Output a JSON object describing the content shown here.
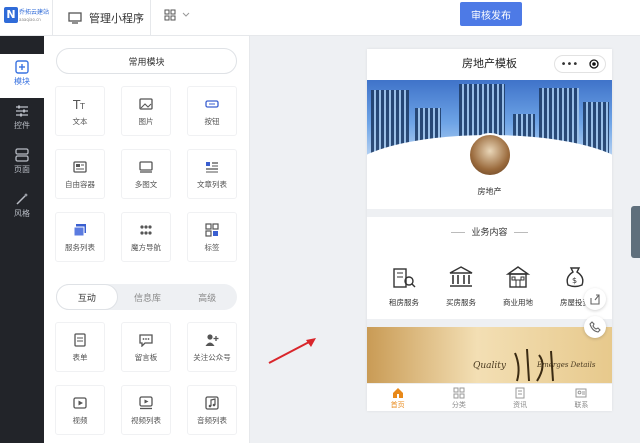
{
  "header": {
    "logo_text": "乔拓云建站",
    "logo_sub": "aaaqiao.cn",
    "manage_label": "管理小程序",
    "publish_label": "审核发布"
  },
  "leftnav": [
    {
      "label": "模块",
      "icon": "plus-square-icon",
      "active": true
    },
    {
      "label": "控件",
      "icon": "sliders-icon",
      "active": false
    },
    {
      "label": "页面",
      "icon": "pages-icon",
      "active": false
    },
    {
      "label": "风格",
      "icon": "magic-wand-icon",
      "active": false
    }
  ],
  "panel": {
    "common_title": "常用模块",
    "common_items": [
      {
        "label": "文本",
        "icon": "text-icon"
      },
      {
        "label": "图片",
        "icon": "image-icon"
      },
      {
        "label": "按钮",
        "icon": "button-icon"
      },
      {
        "label": "自由容器",
        "icon": "container-icon"
      },
      {
        "label": "多图文",
        "icon": "multi-image-icon"
      },
      {
        "label": "文章列表",
        "icon": "article-list-icon"
      },
      {
        "label": "服务列表",
        "icon": "service-list-icon"
      },
      {
        "label": "魔方导航",
        "icon": "cube-nav-icon"
      },
      {
        "label": "标签",
        "icon": "tag-icon"
      }
    ],
    "tabs": [
      "互动",
      "信息库",
      "高级"
    ],
    "interact_items": [
      {
        "label": "表单",
        "icon": "form-icon"
      },
      {
        "label": "留言板",
        "icon": "message-board-icon"
      },
      {
        "label": "关注公众号",
        "icon": "follow-icon"
      },
      {
        "label": "视频",
        "icon": "video-icon"
      },
      {
        "label": "视频列表",
        "icon": "video-list-icon"
      },
      {
        "label": "音频列表",
        "icon": "audio-list-icon"
      }
    ]
  },
  "phone": {
    "title": "房地产模板",
    "brand_name": "房地产",
    "section_title": "业务内容",
    "services": [
      {
        "label": "租房服务",
        "icon": "rent-house-icon"
      },
      {
        "label": "买房服务",
        "icon": "bank-building-icon"
      },
      {
        "label": "商业用地",
        "icon": "commercial-land-icon"
      },
      {
        "label": "房屋投资",
        "icon": "money-bag-icon"
      }
    ],
    "banner_text_1": "Quality",
    "banner_text_2": "Emerges Details",
    "tabbar": [
      {
        "label": "首页",
        "icon": "home-icon",
        "active": true
      },
      {
        "label": "分类",
        "icon": "category-icon",
        "active": false
      },
      {
        "label": "资讯",
        "icon": "news-icon",
        "active": false
      },
      {
        "label": "联系",
        "icon": "contact-icon",
        "active": false
      }
    ]
  },
  "colors": {
    "accent": "#4d7ae6",
    "nav_bg": "#222429",
    "tab_active": "#e8891a"
  }
}
